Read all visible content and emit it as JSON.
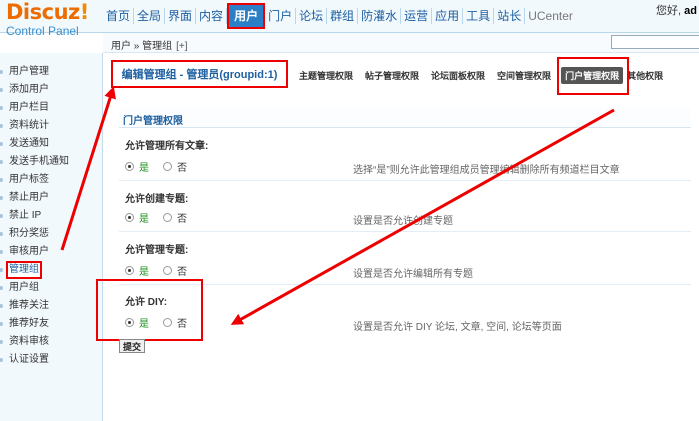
{
  "header": {
    "logo": {
      "brand": "Discuz",
      "bang": "!",
      "sub": "Control Panel"
    },
    "nav": [
      "首页",
      "全局",
      "界面",
      "内容",
      "用户",
      "门户",
      "论坛",
      "群组",
      "防灌水",
      "运营",
      "应用",
      "工具",
      "站长",
      "UCenter"
    ],
    "nav_active": "用户",
    "greeting": "您好,",
    "username": "ad"
  },
  "subbar": {
    "breadcrumb": "用户 » 管理组",
    "plus": "[+]"
  },
  "sidebar": {
    "items": [
      "用户管理",
      "添加用户",
      "用户栏目",
      "资料统计",
      "发送通知",
      "发送手机通知",
      "用户标签",
      "禁止用户",
      "禁止 IP",
      "积分奖惩",
      "审核用户",
      "管理组",
      "用户组",
      "推荐关注",
      "推荐好友",
      "资料审核",
      "认证设置"
    ],
    "active": "管理组"
  },
  "main": {
    "title": "编辑管理组 - 管理员(groupid:1)",
    "tabs": [
      "主题管理权限",
      "帖子管理权限",
      "论坛面板权限",
      "空间管理权限",
      "门户管理权限",
      "其他权限"
    ],
    "active_tab": "门户管理权限",
    "section_title": "门户管理权限",
    "yes": "是",
    "no": "否",
    "rows": [
      {
        "label": "允许管理所有文章:",
        "hint": "选择“是”则允许此管理组成员管理编辑删除所有频道栏目文章",
        "value": "yes"
      },
      {
        "label": "允许创建专题:",
        "hint": "设置是否允许创建专题",
        "value": "yes"
      },
      {
        "label": "允许管理专题:",
        "hint": "设置是否允许编辑所有专题",
        "value": "yes"
      },
      {
        "label": "允许 DIY:",
        "hint": "设置是否允许 DIY 论坛, 文章, 空间, 论坛等页面",
        "value": "yes"
      }
    ],
    "submit": "提交"
  },
  "colors": {
    "highlight": "#e00000",
    "link": "#1d5fa0",
    "brand": "#ee6b00"
  }
}
